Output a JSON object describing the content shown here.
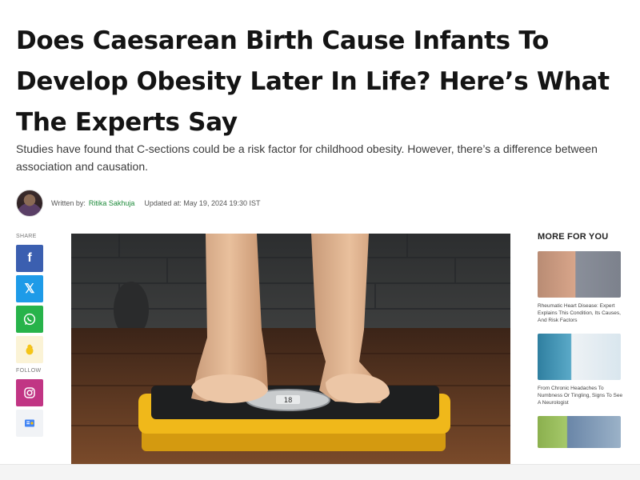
{
  "article": {
    "title": "Does Caesarean Birth Cause Infants To Develop Obesity Later In Life? Here’s What The Experts Say",
    "subtitle": "Studies have found that C-sections could be a risk factor for childhood obesity. However, there’s a difference between association and causation.",
    "written_by_label": "Written by:",
    "author": "Ritika Sakhuja",
    "updated": "Updated at: May 19, 2024 19:30 IST",
    "scale_reading": "18"
  },
  "share": {
    "label": "SHARE",
    "buttons": [
      {
        "name": "facebook",
        "glyph": "f"
      },
      {
        "name": "x",
        "glyph": "𝕏"
      },
      {
        "name": "whatsapp",
        "glyph": "✆"
      },
      {
        "name": "koo",
        "glyph": "🐤"
      }
    ]
  },
  "follow": {
    "label": "FOLLOW",
    "buttons": [
      {
        "name": "instagram",
        "glyph": "◎"
      },
      {
        "name": "google-news",
        "glyph": "G"
      }
    ]
  },
  "more": {
    "title": "MORE FOR YOU",
    "items": [
      {
        "text": "Rheumatic Heart Disease: Expert Explains This Condition, Its Causes, And Risk Factors"
      },
      {
        "text": "From Chronic Headaches To Numbness Or Tingling, Signs To See A Neurologist"
      },
      {
        "text": ""
      }
    ]
  },
  "colors": {
    "facebook": "#3b5fb0",
    "x": "#1e9be8",
    "whatsapp": "#27b34a",
    "instagram": "#c13584",
    "author_link": "#1d8a3a"
  }
}
